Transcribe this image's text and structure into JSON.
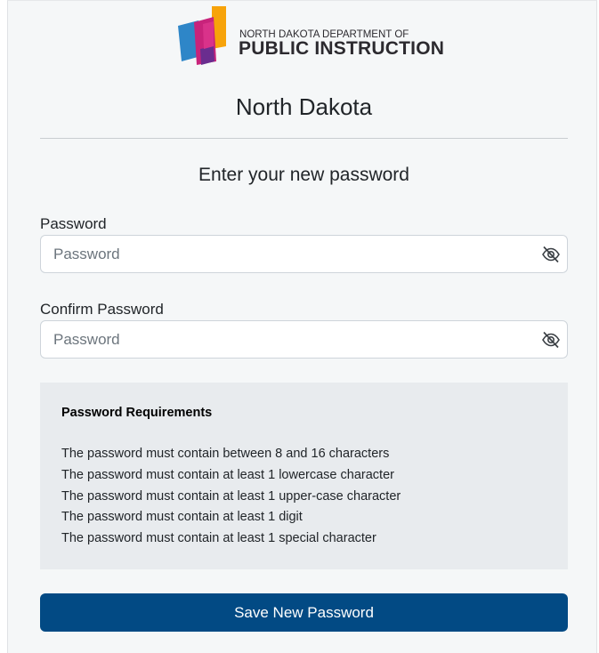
{
  "logo": {
    "line1": "NORTH DAKOTA DEPARTMENT OF",
    "line2": "PUBLIC INSTRUCTION",
    "colors": [
      "#f7a30a",
      "#2e86c8",
      "#c8237b",
      "#6a2d8f"
    ]
  },
  "site_title": "North Dakota",
  "form": {
    "heading": "Enter your new password",
    "password_label": "Password",
    "password_placeholder": "Password",
    "password_value": "",
    "confirm_label": "Confirm Password",
    "confirm_placeholder": "Password",
    "confirm_value": "",
    "toggle_icon": "eye-slash-icon"
  },
  "requirements": {
    "title": "Password Requirements",
    "items": [
      "The password must contain between 8 and 16 characters",
      "The password must contain at least 1 lowercase character",
      "The password must contain at least 1 upper-case character",
      "The password must contain at least 1 digit",
      "The password must contain at least 1 special character"
    ]
  },
  "save_button_label": "Save New Password",
  "colors": {
    "primary": "#024a84",
    "panel": "#e8ebee",
    "background": "#f5f7f8"
  }
}
